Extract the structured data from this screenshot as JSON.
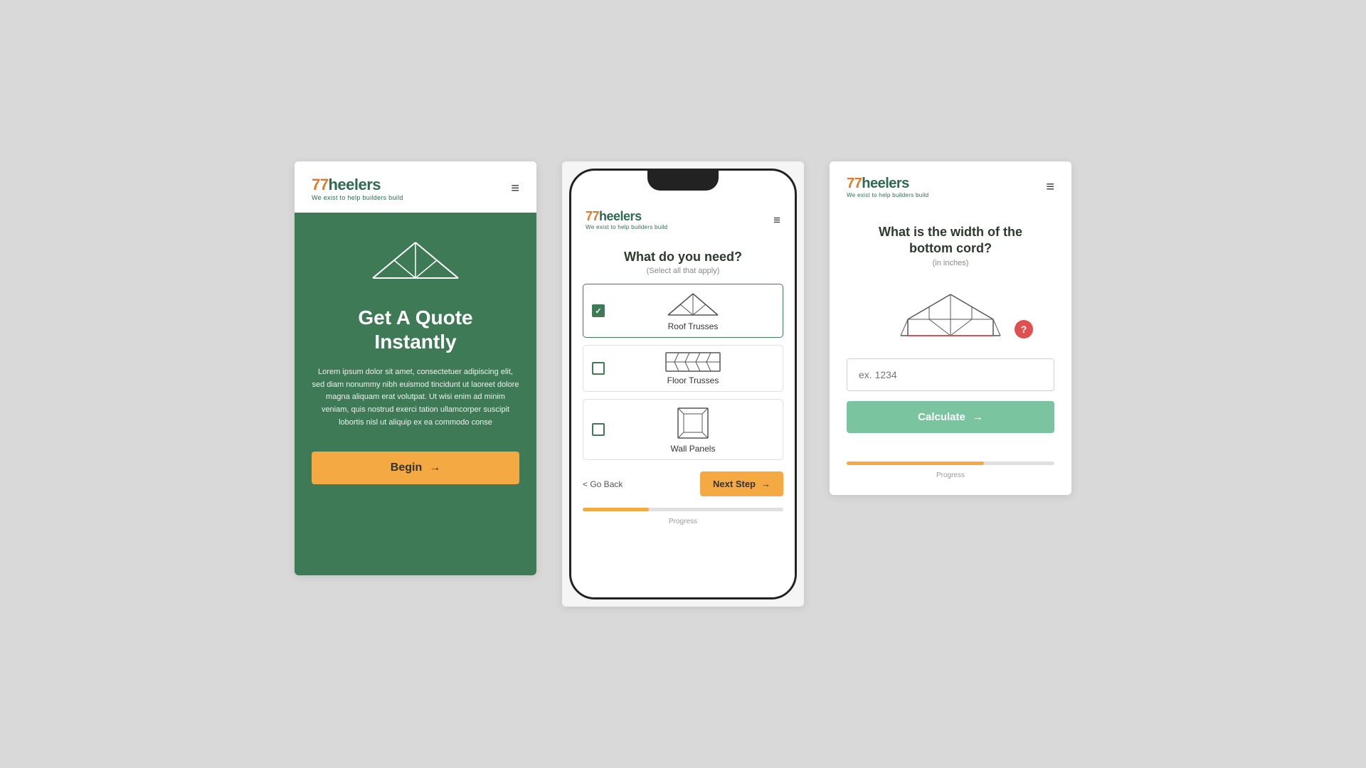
{
  "brand": {
    "name_prefix": "77heelers",
    "name_mark": "7",
    "name_text": "heelers",
    "tagline": "We exist to help builders build"
  },
  "screen1": {
    "hero_title": "Get A Quote\nInstantly",
    "hero_text": "Lorem ipsum dolor sit amet, consectetuer adipiscing elit, sed diam nonummy nibh euismod tincidunt ut laoreet dolore magna aliquam erat volutpat. Ut wisi enim ad minim veniam, quis nostrud exerci tation ullamcorper suscipit lobortis nisl ut aliquip ex ea commodo conse",
    "begin_button": "Begin",
    "arrow": "→"
  },
  "screen2": {
    "question_title": "What do you  need?",
    "question_subtitle": "(Select all that apply)",
    "options": [
      {
        "label": "Roof Trusses",
        "checked": true
      },
      {
        "label": "Floor Trusses",
        "checked": false
      },
      {
        "label": "Wall Panels",
        "checked": false
      }
    ],
    "go_back": "< Go Back",
    "next_step": "Next Step",
    "arrow": "→",
    "progress_label": "Progress",
    "progress_percent": 33
  },
  "screen3": {
    "question_title": "What is the width of the\nbottom cord?",
    "question_subtitle": "(in inches)",
    "input_placeholder": "ex. 1234",
    "calculate_button": "Calculate",
    "arrow": "→",
    "progress_label": "Progress",
    "progress_percent": 66,
    "help_label": "?"
  },
  "hamburger": "≡"
}
